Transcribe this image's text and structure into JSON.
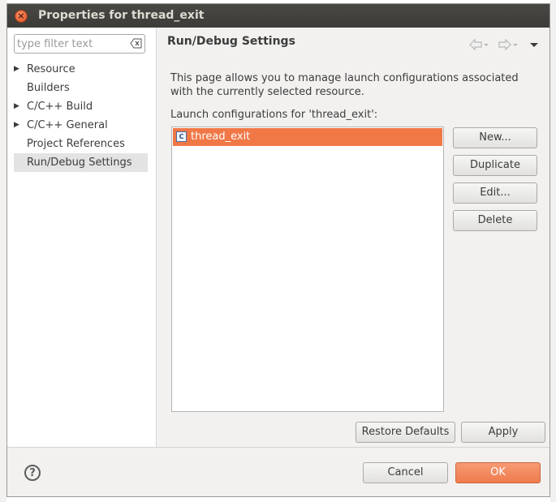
{
  "dialog": {
    "title": "Properties for thread_exit"
  },
  "filter": {
    "placeholder": "type filter text"
  },
  "tree": {
    "items": [
      {
        "label": "Resource",
        "expandable": true
      },
      {
        "label": "Builders",
        "expandable": false
      },
      {
        "label": "C/C++ Build",
        "expandable": true
      },
      {
        "label": "C/C++ General",
        "expandable": true
      },
      {
        "label": "Project References",
        "expandable": false
      },
      {
        "label": "Run/Debug Settings",
        "expandable": false,
        "selected": true
      }
    ]
  },
  "page": {
    "title": "Run/Debug Settings",
    "description": "This page allows you to manage launch configurations associated with the currently selected resource.",
    "list_label": "Launch configurations for 'thread_exit':",
    "configurations": [
      {
        "name": "thread_exit",
        "icon": "c-launch-config-icon",
        "selected": true
      }
    ],
    "buttons": {
      "new": "New...",
      "duplicate": "Duplicate",
      "edit": "Edit...",
      "delete": "Delete"
    },
    "restore_defaults": "Restore Defaults",
    "apply": "Apply"
  },
  "footer": {
    "cancel": "Cancel",
    "ok": "OK"
  },
  "colors": {
    "accent": "#f07746",
    "titlebar": "#3c3b37"
  }
}
